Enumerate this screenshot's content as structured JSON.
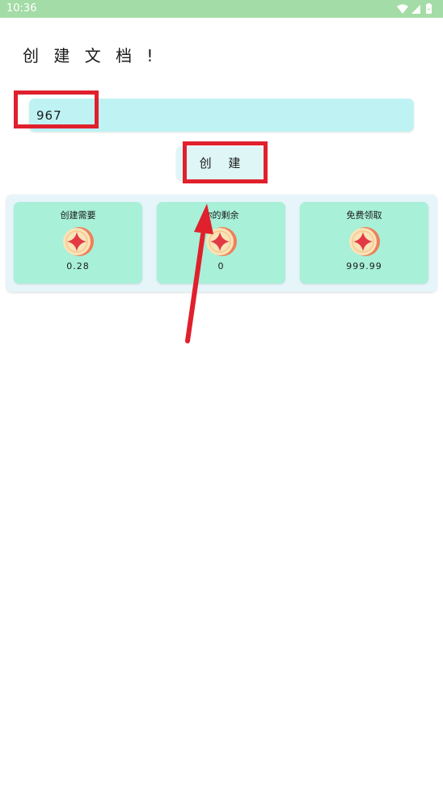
{
  "status_bar": {
    "time": "10:36",
    "icons": [
      "wifi-icon",
      "cellular-signal-icon",
      "battery-icon"
    ]
  },
  "page": {
    "title": "创 建 文 档 !"
  },
  "name_input": {
    "value": "967"
  },
  "create_button": {
    "label": "创 建"
  },
  "stats": [
    {
      "title": "创建需要",
      "value": "0.28",
      "icon": "coin-icon"
    },
    {
      "title": "你的剩余",
      "value": "0",
      "icon": "coin-icon"
    },
    {
      "title": "免费领取",
      "value": "999.99",
      "icon": "coin-icon"
    }
  ],
  "annotations": {
    "color": "#e0202c",
    "highlights": [
      "name-input",
      "create-button"
    ],
    "arrow_target": "create-button"
  },
  "colors": {
    "status_bar": "#a3dca6",
    "input_bg": "#bff3f3",
    "button_bg": "#dff6f7",
    "panel_bg": "#e6f5fa",
    "card_bg": "#a8f0d8",
    "coin_face": "#f9e3b8",
    "coin_rim": "#ef7f5a",
    "coin_star": "#e23a44"
  }
}
